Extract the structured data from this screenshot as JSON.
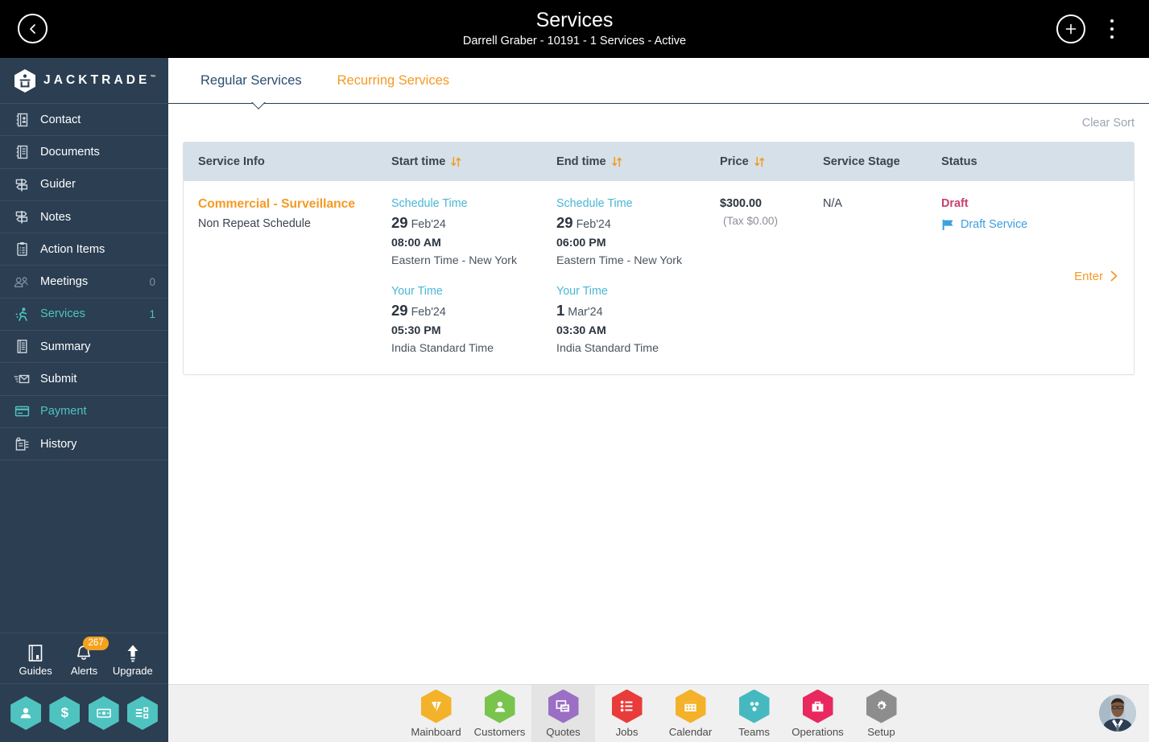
{
  "topbar": {
    "back_icon": "chevron-left-icon",
    "title": "Services",
    "subtitle": "Darrell Graber - 10191 - 1 Services - Active",
    "add_icon": "plus-circle-icon",
    "menu_icon": "kebab-menu-icon"
  },
  "sidebar": {
    "logo_text": "JACKTRADE",
    "logo_tm": "™",
    "items": [
      {
        "label": "Contact",
        "icon": "contact-book-icon",
        "count": "",
        "state": "normal"
      },
      {
        "label": "Documents",
        "icon": "document-icon",
        "count": "",
        "state": "normal"
      },
      {
        "label": "Guider",
        "icon": "signpost-icon",
        "count": "",
        "state": "normal"
      },
      {
        "label": "Notes",
        "icon": "signpost-icon",
        "count": "",
        "state": "normal"
      },
      {
        "label": "Action Items",
        "icon": "clipboard-icon",
        "count": "",
        "state": "normal"
      },
      {
        "label": "Meetings",
        "icon": "meeting-icon",
        "count": "0",
        "state": "dim"
      },
      {
        "label": "Services",
        "icon": "service-icon",
        "count": "1",
        "state": "teal"
      },
      {
        "label": "Summary",
        "icon": "summary-icon",
        "count": "",
        "state": "normal"
      },
      {
        "label": "Submit",
        "icon": "submit-mail-icon",
        "count": "",
        "state": "normal"
      },
      {
        "label": "Payment",
        "icon": "payment-card-icon",
        "count": "",
        "state": "teal"
      },
      {
        "label": "History",
        "icon": "history-icon",
        "count": "",
        "state": "normal"
      }
    ],
    "tools": [
      {
        "label": "Guides",
        "icon": "book-icon",
        "badge": ""
      },
      {
        "label": "Alerts",
        "icon": "bell-icon",
        "badge": "267"
      },
      {
        "label": "Upgrade",
        "icon": "up-arrow-icon",
        "badge": ""
      }
    ],
    "hex_shortcuts": [
      {
        "icon": "person-hex-icon"
      },
      {
        "icon": "dollar-hex-icon"
      },
      {
        "icon": "money-hex-icon"
      },
      {
        "icon": "workflow-hex-icon"
      }
    ]
  },
  "main": {
    "tabs": [
      {
        "label": "Regular Services",
        "active": true
      },
      {
        "label": "Recurring Services",
        "active": false
      }
    ],
    "clear_sort": "Clear Sort",
    "columns": [
      {
        "label": "Service Info",
        "sortable": false
      },
      {
        "label": "Start time",
        "sortable": true
      },
      {
        "label": "End time",
        "sortable": true
      },
      {
        "label": "Price",
        "sortable": true
      },
      {
        "label": "Service Stage",
        "sortable": false
      },
      {
        "label": "Status",
        "sortable": false
      }
    ],
    "rows": [
      {
        "service_title": "Commercial - Surveillance",
        "service_subtitle": "Non Repeat Schedule",
        "start": {
          "schedule_label": "Schedule Time",
          "schedule_day": "29",
          "schedule_month": "Feb'24",
          "schedule_hour": "08:00 AM",
          "schedule_zone": "Eastern Time - New York",
          "your_label": "Your Time",
          "your_day": "29",
          "your_month": "Feb'24",
          "your_hour": "05:30 PM",
          "your_zone": "India Standard Time"
        },
        "end": {
          "schedule_label": "Schedule Time",
          "schedule_day": "29",
          "schedule_month": "Feb'24",
          "schedule_hour": "06:00 PM",
          "schedule_zone": "Eastern Time - New York",
          "your_label": "Your Time",
          "your_day": "1",
          "your_month": "Mar'24",
          "your_hour": "03:30 AM",
          "your_zone": "India Standard Time"
        },
        "price": "$300.00",
        "tax": "(Tax $0.00)",
        "stage": "N/A",
        "status": "Draft",
        "status_sub": "Draft Service",
        "status_sub_icon": "flag-icon",
        "enter_label": "Enter",
        "enter_icon": "chevron-right-icon"
      }
    ]
  },
  "bottomnav": {
    "items": [
      {
        "label": "Mainboard",
        "icon": "mainboard-hex-icon",
        "color": "#f3b229",
        "active": false
      },
      {
        "label": "Customers",
        "icon": "customers-hex-icon",
        "color": "#79c44d",
        "active": false
      },
      {
        "label": "Quotes",
        "icon": "quotes-hex-icon",
        "color": "#9b6fc4",
        "active": true
      },
      {
        "label": "Jobs",
        "icon": "jobs-hex-icon",
        "color": "#ea3b3b",
        "active": false
      },
      {
        "label": "Calendar",
        "icon": "calendar-hex-icon",
        "color": "#f3b229",
        "active": false
      },
      {
        "label": "Teams",
        "icon": "teams-hex-icon",
        "color": "#45b9bf",
        "active": false
      },
      {
        "label": "Operations",
        "icon": "operations-hex-icon",
        "color": "#e8285e",
        "active": false
      },
      {
        "label": "Setup",
        "icon": "setup-hex-icon",
        "color": "#8d8d8d",
        "active": false
      }
    ],
    "avatar_icon": "user-avatar"
  },
  "colors": {
    "sidebar_bg": "#2b3e52",
    "accent_orange": "#f59a23",
    "accent_teal": "#4fc3c0",
    "table_header": "#d6e0e8",
    "status_draft": "#c94070",
    "link_blue": "#3d9fe0"
  }
}
